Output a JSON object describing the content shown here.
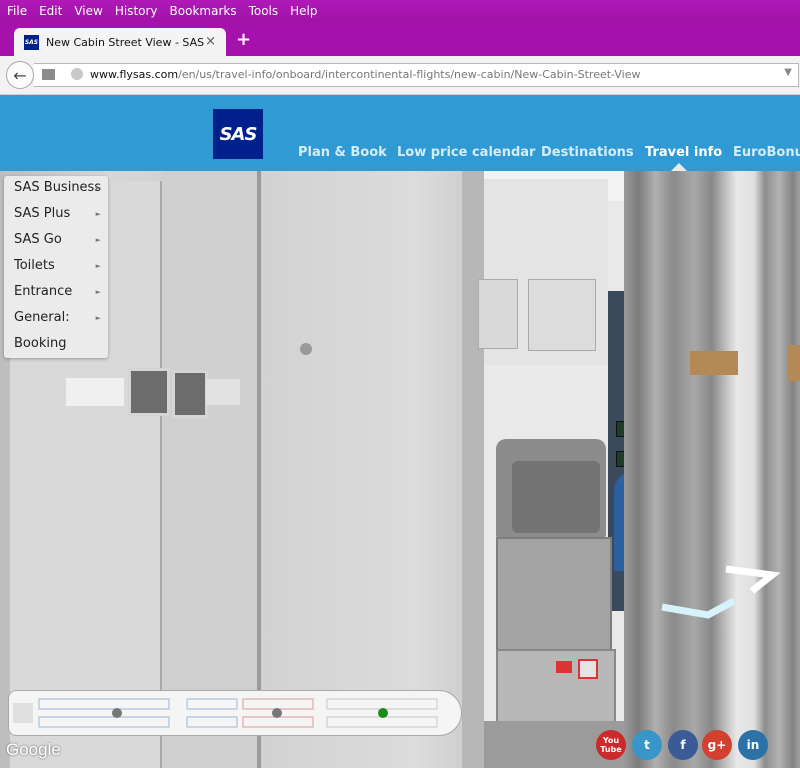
{
  "menubar": {
    "items": [
      "File",
      "Edit",
      "View",
      "History",
      "Bookmarks",
      "Tools",
      "Help"
    ]
  },
  "tab": {
    "favicon_text": "SAS",
    "title": "New Cabin Street View - SAS",
    "close_glyph": "×",
    "new_tab_glyph": "+"
  },
  "address": {
    "url_host": "www.flysas.com",
    "url_path": "/en/us/travel-info/onboard/intercontinental-flights/new-cabin/New-Cabin-Street-View"
  },
  "site": {
    "logo_text": "SAS",
    "nav": [
      {
        "label": "Plan & Book",
        "active": false
      },
      {
        "label": "Low price calendar",
        "active": false
      },
      {
        "label": "Destinations",
        "active": false
      },
      {
        "label": "Travel info",
        "active": true
      },
      {
        "label": "EuroBonus",
        "active": false
      }
    ]
  },
  "panorama_menu": {
    "items": [
      {
        "label": "SAS Business",
        "has_submenu": true
      },
      {
        "label": "SAS Plus",
        "has_submenu": true
      },
      {
        "label": "SAS Go",
        "has_submenu": true
      },
      {
        "label": "Toilets",
        "has_submenu": true
      },
      {
        "label": "Entrance",
        "has_submenu": true
      },
      {
        "label": "General:",
        "has_submenu": true
      },
      {
        "label": "Booking",
        "has_submenu": false
      }
    ]
  },
  "attribution": "Google",
  "social": [
    {
      "name": "youtube",
      "label": "You Tube",
      "color": "#cc2a2a"
    },
    {
      "name": "twitter",
      "label": "t",
      "color": "#3a95c9"
    },
    {
      "name": "facebook",
      "label": "f",
      "color": "#3b5b97"
    },
    {
      "name": "google-plus",
      "label": "g+",
      "color": "#d2412f"
    },
    {
      "name": "linkedin",
      "label": "in",
      "color": "#2a72a8"
    }
  ],
  "colors": {
    "browser_chrome": "#a512ab",
    "site_header": "#2f9ad4",
    "logo_bg": "#00208c",
    "minimap_current_marker": "#1a8a1a",
    "minimap_marker": "#777777"
  }
}
